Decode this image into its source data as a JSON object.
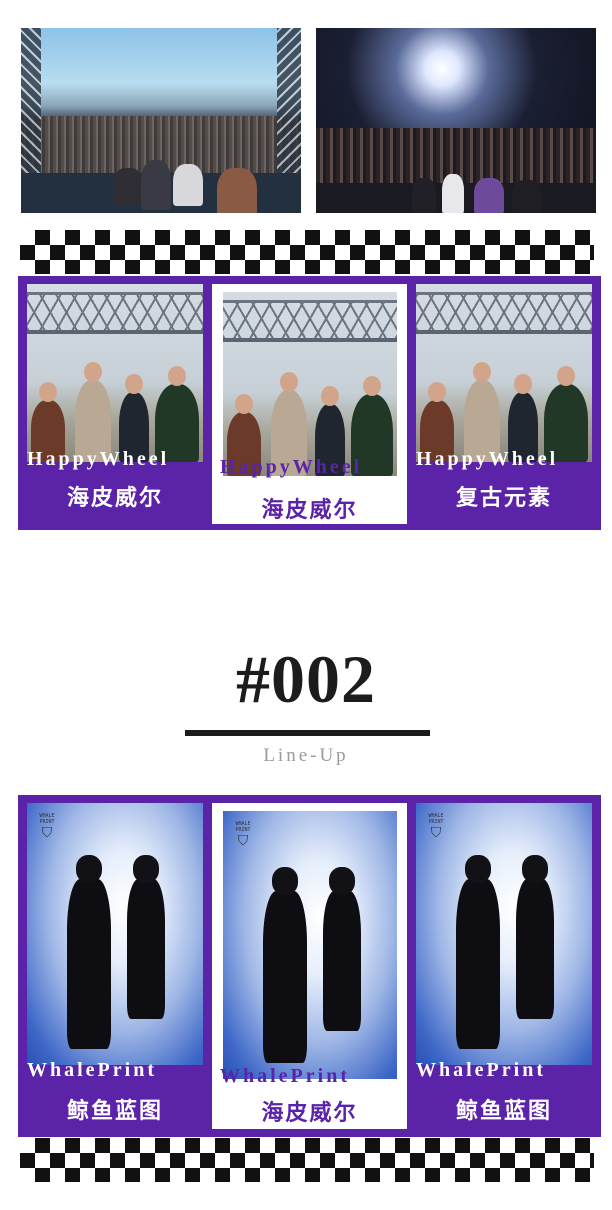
{
  "photos": {
    "top_left": "outdoor-festival-stage-photo",
    "top_right": "indoor-club-stage-photo"
  },
  "section_1": {
    "cards": [
      {
        "en": "HappyWheel",
        "zh": "海皮威尔",
        "style": "purple"
      },
      {
        "en": "HappyWheel",
        "zh": "海皮威尔",
        "style": "white"
      },
      {
        "en": "HappyWheel",
        "zh": "复古元素",
        "style": "purple"
      }
    ]
  },
  "heading": {
    "number": "#002",
    "subtitle": "Line-Up"
  },
  "section_2": {
    "cards": [
      {
        "en": "WhalePrint",
        "zh": "鲸鱼蓝图",
        "style": "purple",
        "logo": "WHALE PRINT"
      },
      {
        "en": "WhalePrint",
        "zh": "海皮威尔",
        "style": "white",
        "logo": "WHALE PRINT"
      },
      {
        "en": "WhalePrint",
        "zh": "鲸鱼蓝图",
        "style": "purple",
        "logo": "WHALE PRINT"
      }
    ]
  },
  "colors": {
    "purple": "#5a23a8",
    "text_dark": "#1c1c1c",
    "subtitle_gray": "#9a9a9a"
  }
}
